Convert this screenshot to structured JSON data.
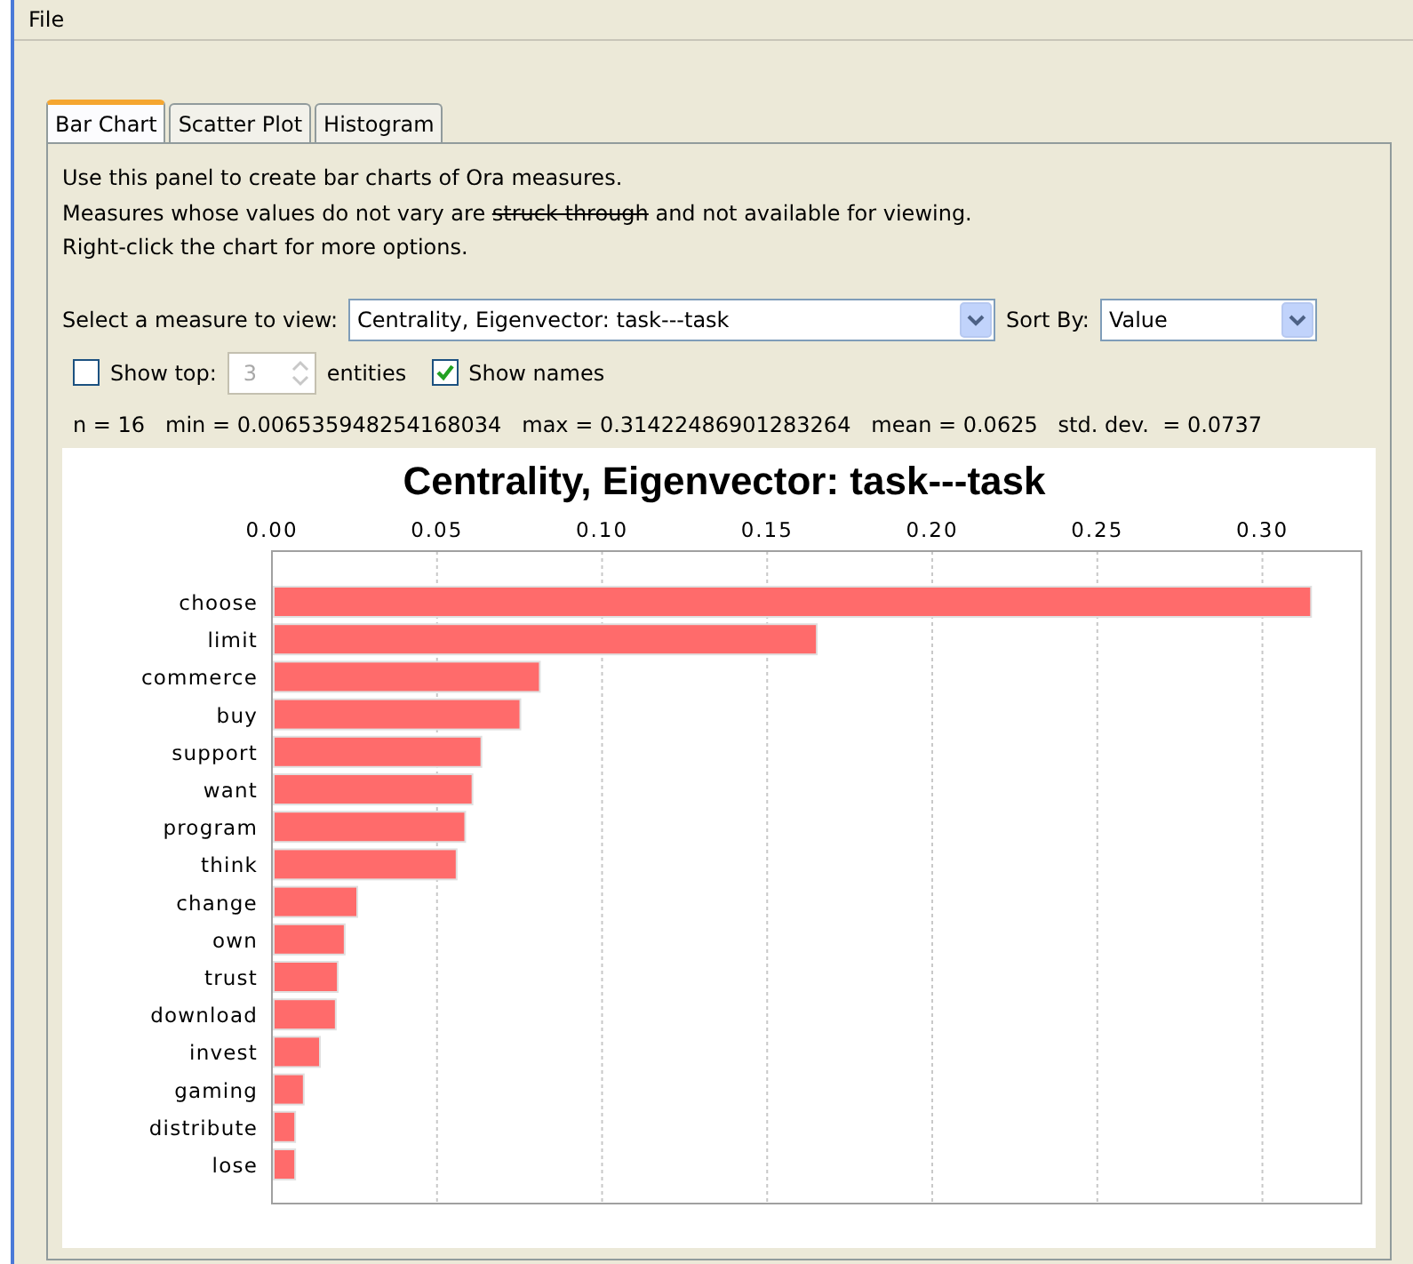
{
  "menu": [
    "File"
  ],
  "tabs": [
    {
      "label": "Bar Chart",
      "selected": true
    },
    {
      "label": "Scatter Plot",
      "selected": false
    },
    {
      "label": "Histogram",
      "selected": false
    }
  ],
  "instructions": [
    [
      {
        "text": "Use this panel to create bar charts of Ora measures.",
        "struck": false
      }
    ],
    [
      {
        "text": "Measures whose values do not vary are ",
        "struck": false
      },
      {
        "text": "struck through",
        "struck": true
      },
      {
        "text": " and not available for viewing.",
        "struck": false
      }
    ],
    [
      {
        "text": "Right-click the chart for more options.",
        "struck": false
      }
    ]
  ],
  "measure": {
    "label": "Select a measure to view:",
    "value": "Centrality, Eigenvector: task---task"
  },
  "sort": {
    "label": "Sort By:",
    "value": "Value"
  },
  "show_top": {
    "label": "Show top:",
    "checked": false,
    "value": "3",
    "suffix": "entities"
  },
  "show_names": {
    "label": "Show names",
    "checked": true
  },
  "stats": "n = 16   min = 0.006535948254168034   max = 0.31422486901283264   mean = 0.0625   std. dev.  = 0.0737",
  "chart": {
    "chart_data": {
      "type": "bar",
      "orientation": "horizontal",
      "title": "Centrality, Eigenvector: task---task",
      "categories": [
        "choose",
        "limit",
        "commerce",
        "buy",
        "support",
        "want",
        "program",
        "think",
        "change",
        "own",
        "trust",
        "download",
        "invest",
        "gaming",
        "distribute",
        "lose"
      ],
      "values": [
        0.3142,
        0.1645,
        0.0806,
        0.0747,
        0.0629,
        0.0602,
        0.058,
        0.0554,
        0.0253,
        0.0215,
        0.0194,
        0.0188,
        0.014,
        0.0091,
        0.0065,
        0.0065
      ],
      "xlim": [
        0,
        0.33
      ],
      "grid": true,
      "xticks": [
        {
          "value": 0,
          "label": "0.00"
        },
        {
          "value": 0.05,
          "label": "0.05"
        },
        {
          "value": 0.1,
          "label": "0.10"
        },
        {
          "value": 0.15,
          "label": "0.15"
        },
        {
          "value": 0.2,
          "label": "0.20"
        },
        {
          "value": 0.25,
          "label": "0.25"
        },
        {
          "value": 0.3,
          "label": "0.30"
        }
      ]
    }
  }
}
